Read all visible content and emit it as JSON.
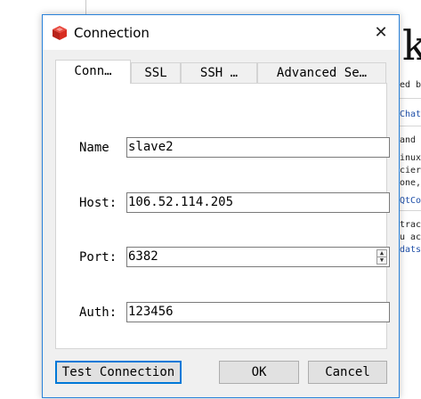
{
  "window": {
    "title": "Connection",
    "close_glyph": "✕",
    "icon": "redis-cube-icon"
  },
  "tabs": [
    {
      "label": "Conn…",
      "active": true
    },
    {
      "label": "SSL",
      "active": false
    },
    {
      "label": "SSH …",
      "active": false
    },
    {
      "label": "Advanced Se…",
      "active": false
    }
  ],
  "form": {
    "name_label": "Name",
    "name_value": "slave2",
    "host_label": "Host:",
    "host_value": "106.52.114.205",
    "port_label": "Port:",
    "port_value": "6382",
    "auth_label": "Auth:",
    "auth_value": "123456"
  },
  "buttons": {
    "test": "Test Connection",
    "ok": "OK",
    "cancel": "Cancel"
  },
  "background": {
    "big_letter": "k",
    "lines": [
      {
        "text": "ed b",
        "link": false
      },
      {
        "text": "Chat",
        "link": true
      },
      {
        "text": "and",
        "link": false
      },
      {
        "text": "inux",
        "link": false
      },
      {
        "text": "cier",
        "link": false
      },
      {
        "text": "one,",
        "link": false
      },
      {
        "text": "QtCo",
        "link": true
      },
      {
        "text": "trac",
        "link": false
      },
      {
        "text": "u ac",
        "link": false
      },
      {
        "text": "dats",
        "link": true
      }
    ]
  },
  "colors": {
    "accent": "#0078d7",
    "window_border": "#2a82da",
    "redis_red": "#d82c20"
  }
}
